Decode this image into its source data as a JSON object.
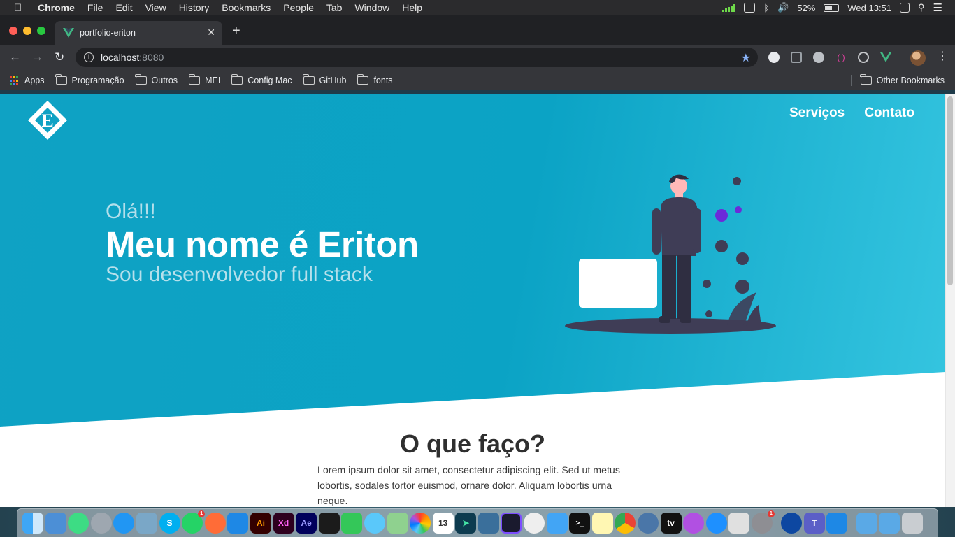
{
  "menubar": {
    "app_name": "Chrome",
    "menus": [
      "File",
      "Edit",
      "View",
      "History",
      "Bookmarks",
      "People",
      "Tab",
      "Window",
      "Help"
    ],
    "battery": "52%",
    "clock": "Wed 13:51"
  },
  "browser": {
    "tab_title": "portfolio-eriton",
    "url_host": "localhost",
    "url_port": ":8080",
    "bookmarks": [
      "Apps",
      "Programação",
      "Outros",
      "MEI",
      "Config Mac",
      "GitHub",
      "fonts"
    ],
    "other_bookmarks": "Other Bookmarks"
  },
  "site": {
    "logo_letter": "E",
    "nav": [
      "Serviços",
      "Contato"
    ],
    "hero": {
      "greeting": "Olá!!!",
      "name": "Meu nome é Eriton",
      "role": "Sou desenvolvedor full stack"
    },
    "section": {
      "title": "O que faço?",
      "text": "Lorem ipsum dolor sit amet, consectetur adipiscing elit. Sed ut metus lobortis, sodales tortor euismod, ornare dolor. Aliquam lobortis urna neque."
    }
  },
  "dock": {
    "badges": {
      "whatsapp": "1",
      "system-preferences": "1"
    },
    "calendar_day": "13",
    "xd_label": "Xd",
    "ai_label": "Ai",
    "ae_label": "Ae",
    "tv_label": "tv"
  },
  "colors": {
    "hero_start": "#0fa2c4",
    "hero_end": "#35c5e0",
    "accent_purple": "#6c2bd9"
  }
}
